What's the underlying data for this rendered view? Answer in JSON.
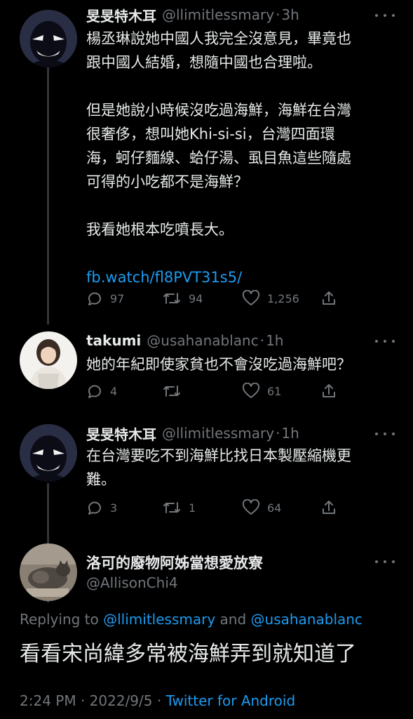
{
  "tweets": [
    {
      "name": "旻旻特木耳",
      "handle": "@llimitlessmary",
      "time": "3h",
      "lines": [
        "楊丞琳說她中國人我完全沒意見，畢竟也",
        "跟中國人結婚，想隨中國也合理啦。",
        "",
        "但是她說小時候沒吃過海鮮，海鮮在台灣",
        "很奢侈，想叫她Khi-si-si，台灣四面環",
        "海，蚵仔麵線、蛤仔湯、虱目魚這些隨處",
        "可得的小吃都不是海鮮？",
        "",
        "我看她根本吃噴長大。",
        ""
      ],
      "link": "fb.watch/fl8PVT31s5/",
      "replies": "97",
      "retweets": "94",
      "likes": "1,256",
      "avatar": "detective-silhouette"
    },
    {
      "name": "takumi",
      "handle": "@usahanablanc",
      "time": "1h",
      "lines": [
        "她的年紀即使家貧也不會沒吃過海鮮吧？"
      ],
      "replies": "4",
      "retweets": "",
      "likes": "61",
      "avatar": "woman-photo"
    },
    {
      "name": "旻旻特木耳",
      "handle": "@llimitlessmary",
      "time": "1h",
      "lines": [
        "在台灣要吃不到海鮮比找日本製壓縮機更",
        "難。"
      ],
      "replies": "3",
      "retweets": "1",
      "likes": "64",
      "avatar": "detective-silhouette"
    }
  ],
  "main": {
    "name": "洛可的廢物阿姊當想愛放寮",
    "handle": "@AllisonChi4",
    "replying_prefix": "Replying to ",
    "mention1": "@llimitlessmary",
    "and": " and ",
    "mention2": "@usahanablanc",
    "text": "看看宋尚緯多常被海鮮弄到就知道了",
    "time": "2:24 PM",
    "date": "2022/9/5",
    "source": "Twitter for Android",
    "avatar": "cat-photo"
  },
  "colors": {
    "background": "#000000",
    "text": "#e7e9ea",
    "muted": "#71767b",
    "link": "#1d9bf0"
  }
}
